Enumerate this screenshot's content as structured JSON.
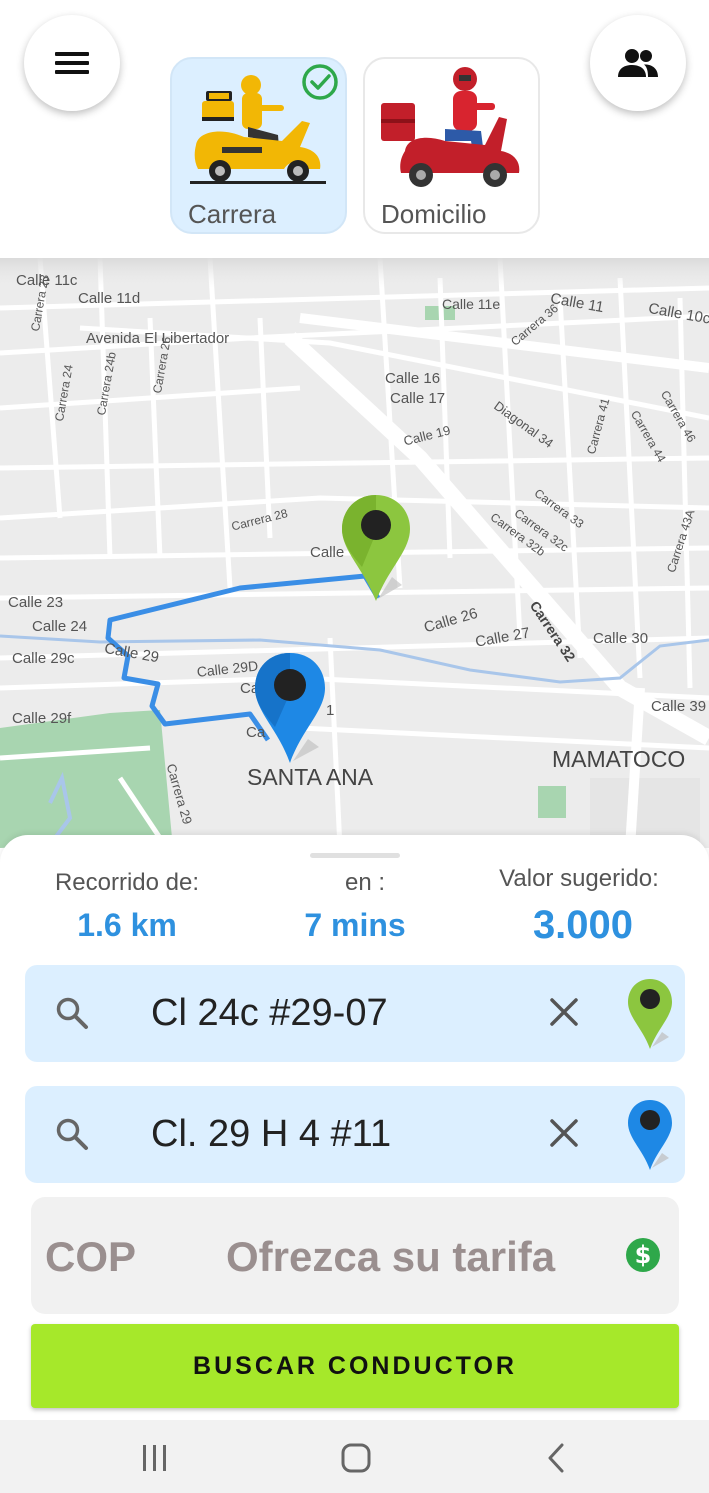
{
  "header": {
    "menu_icon": "hamburger-menu-icon",
    "users_icon": "users-icon",
    "services": [
      {
        "label": "Carrera",
        "selected": true,
        "icon": "taxi-scooter-icon"
      },
      {
        "label": "Domicilio",
        "selected": false,
        "icon": "delivery-scooter-icon"
      }
    ]
  },
  "map": {
    "streets": [
      "Calle 11c",
      "Calle 11d",
      "Carrera 23",
      "Carrera 24",
      "Carrera 24b",
      "Carrera 26",
      "Avenida El Libertador",
      "Calle 11e",
      "Calle 11",
      "Calle 10c",
      "Carrera 36",
      "Calle 16",
      "Calle 17",
      "Calle 19",
      "Diagonal 34",
      "Carrera 41",
      "Carrera 44",
      "Carrera 46",
      "Carrera 28",
      "Carrera 33",
      "Carrera 32c",
      "Carrera 32b",
      "Carrera 43A",
      "Calle",
      "Calle 23",
      "Calle 24",
      "Calle 29",
      "Calle 29c",
      "Calle 29D",
      "Calle 26",
      "Calle 27",
      "Carrera 32",
      "Calle 30",
      "Calle 39",
      "Calle 29f",
      "Carrera 29",
      "Ca",
      "Ca",
      "1"
    ],
    "neighborhoods": [
      "SANTA ANA",
      "MAMATOCO"
    ],
    "origin_pin_color": "#8cc63f",
    "destination_pin_color": "#1e88e5",
    "route_color": "#3a8ee6"
  },
  "trip": {
    "distance_label": "Recorrido de:",
    "distance_value": "1.6 km",
    "time_label": "en :",
    "time_value": "7 mins",
    "price_label": "Valor sugerido:",
    "price_value": "3.000"
  },
  "origin": {
    "address": "Cl 24c #29-07",
    "icon": "green-location-pin-icon"
  },
  "destination": {
    "address": "Cl. 29 H 4 #11",
    "icon": "blue-location-pin-icon"
  },
  "fare": {
    "currency": "COP",
    "placeholder": "Ofrezca su tarifa",
    "icon": "dollar-circle-icon"
  },
  "cta": {
    "label": "BUSCAR CONDUCTOR"
  },
  "colors": {
    "accent": "#2e91df",
    "cta": "#a6e82a",
    "input_bg": "#dcefff",
    "check": "#2ea84a"
  }
}
